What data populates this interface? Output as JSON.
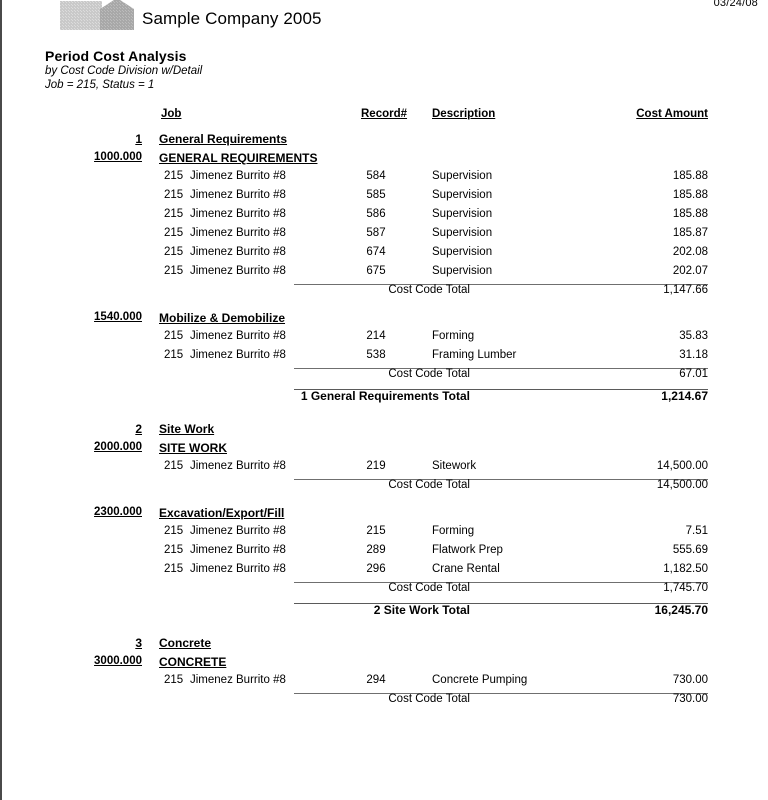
{
  "header": {
    "date": "03/24/08",
    "company_name": "Sample Company 2005",
    "logo_icon": "building-logo-icon"
  },
  "title_block": {
    "title": "Period Cost Analysis",
    "subtitle": "by Cost Code Division w/Detail",
    "filter": "Job = 215, Status = 1"
  },
  "columns": {
    "job": "Job",
    "record": "Record#",
    "description": "Description",
    "cost_amount": "Cost Amount"
  },
  "labels": {
    "cost_code_total": "Cost Code Total"
  },
  "divisions": [
    {
      "number": "1",
      "name": "General Requirements",
      "total_label": "1 General Requirements Total",
      "total_amount": "1,214.67",
      "cost_codes": [
        {
          "code": "1000.000",
          "name": "GENERAL REQUIREMENTS",
          "rows": [
            {
              "job_no": "215",
              "job_name": "Jimenez Burrito #8",
              "record": "584",
              "description": "Supervision",
              "amount": "185.88"
            },
            {
              "job_no": "215",
              "job_name": "Jimenez Burrito #8",
              "record": "585",
              "description": "Supervision",
              "amount": "185.88"
            },
            {
              "job_no": "215",
              "job_name": "Jimenez Burrito #8",
              "record": "586",
              "description": "Supervision",
              "amount": "185.88"
            },
            {
              "job_no": "215",
              "job_name": "Jimenez Burrito #8",
              "record": "587",
              "description": "Supervision",
              "amount": "185.87"
            },
            {
              "job_no": "215",
              "job_name": "Jimenez Burrito #8",
              "record": "674",
              "description": "Supervision",
              "amount": "202.08"
            },
            {
              "job_no": "215",
              "job_name": "Jimenez Burrito #8",
              "record": "675",
              "description": "Supervision",
              "amount": "202.07"
            }
          ],
          "total_amount": "1,147.66"
        },
        {
          "code": "1540.000",
          "name": "Mobilize & Demobilize",
          "rows": [
            {
              "job_no": "215",
              "job_name": "Jimenez Burrito #8",
              "record": "214",
              "description": "Forming",
              "amount": "35.83"
            },
            {
              "job_no": "215",
              "job_name": "Jimenez Burrito #8",
              "record": "538",
              "description": "Framing Lumber",
              "amount": "31.18"
            }
          ],
          "total_amount": "67.01"
        }
      ]
    },
    {
      "number": "2",
      "name": "Site Work",
      "total_label": "2 Site Work Total",
      "total_amount": "16,245.70",
      "cost_codes": [
        {
          "code": "2000.000",
          "name": "SITE WORK",
          "rows": [
            {
              "job_no": "215",
              "job_name": "Jimenez Burrito #8",
              "record": "219",
              "description": "Sitework",
              "amount": "14,500.00"
            }
          ],
          "total_amount": "14,500.00"
        },
        {
          "code": "2300.000",
          "name": "Excavation/Export/Fill",
          "rows": [
            {
              "job_no": "215",
              "job_name": "Jimenez Burrito #8",
              "record": "215",
              "description": "Forming",
              "amount": "7.51"
            },
            {
              "job_no": "215",
              "job_name": "Jimenez Burrito #8",
              "record": "289",
              "description": "Flatwork Prep",
              "amount": "555.69"
            },
            {
              "job_no": "215",
              "job_name": "Jimenez Burrito #8",
              "record": "296",
              "description": "Crane Rental",
              "amount": "1,182.50"
            }
          ],
          "total_amount": "1,745.70"
        }
      ]
    },
    {
      "number": "3",
      "name": "Concrete",
      "total_label": "",
      "total_amount": "",
      "cost_codes": [
        {
          "code": "3000.000",
          "name": "CONCRETE",
          "rows": [
            {
              "job_no": "215",
              "job_name": "Jimenez Burrito #8",
              "record": "294",
              "description": "Concrete Pumping",
              "amount": "730.00"
            }
          ],
          "total_amount": "730.00"
        }
      ]
    }
  ]
}
